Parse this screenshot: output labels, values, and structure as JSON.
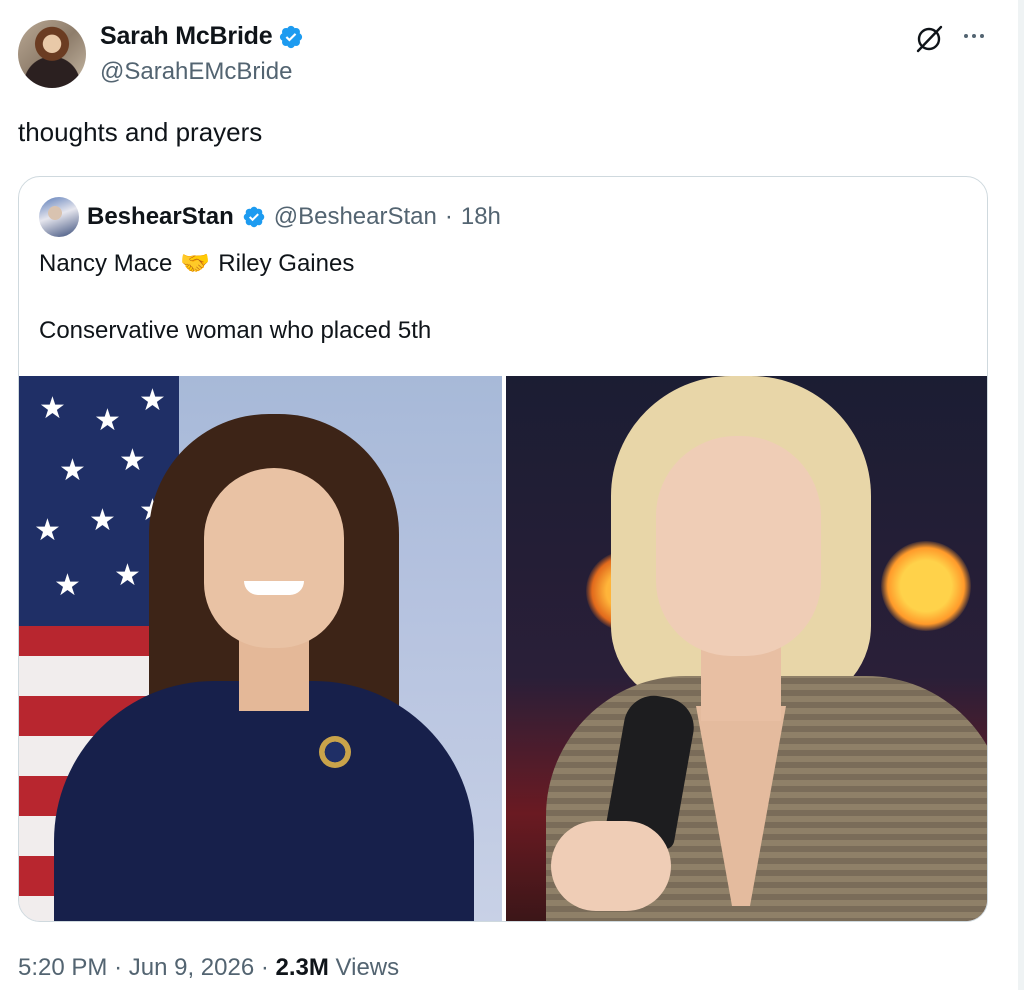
{
  "author": {
    "display_name": "Sarah McBride",
    "handle": "@SarahEMcBride",
    "verified": true
  },
  "tweet": {
    "text": "thoughts and prayers"
  },
  "quoted": {
    "display_name": "BeshearStan",
    "handle": "@BeshearStan",
    "separator": "·",
    "age": "18h",
    "line1_left": "Nancy Mace",
    "line1_emoji": "🤝",
    "line1_right": "Riley Gaines",
    "line2": "Conservative woman who placed 5th"
  },
  "meta": {
    "time": "5:20 PM",
    "sep1": "·",
    "date": "Jun 9, 2026",
    "sep2": "·",
    "views_count": "2.3M",
    "views_label": "Views"
  },
  "icons": {
    "verified": "verified-badge-icon",
    "grok": "grok-icon",
    "more": "more-options-icon"
  },
  "colors": {
    "text": "#0f1419",
    "secondary": "#536471",
    "verified_blue": "#1d9bf0",
    "border": "#cfd9de"
  }
}
